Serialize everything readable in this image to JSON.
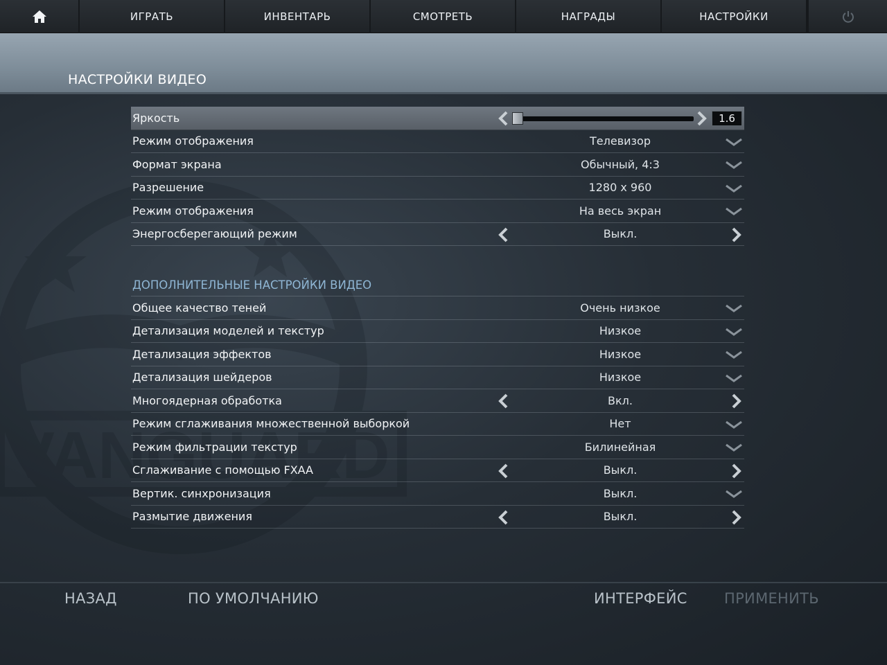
{
  "nav": {
    "items": [
      {
        "label": "ИГРАТЬ"
      },
      {
        "label": "ИНВЕНТАРЬ"
      },
      {
        "label": "СМОТРЕТЬ"
      },
      {
        "label": "НАГРАДЫ"
      },
      {
        "label": "НАСТРОЙКИ"
      }
    ],
    "home_icon": "home-icon",
    "power_icon": "power-icon"
  },
  "page": {
    "title": "НАСТРОЙКИ ВИДЕО"
  },
  "brightness": {
    "label": "Яркость",
    "value": "1.6",
    "slider_fraction": 0.0
  },
  "basic": [
    {
      "label": "Режим отображения",
      "value": "Телевизор",
      "control": "dropdown"
    },
    {
      "label": "Формат экрана",
      "value": "Обычный, 4:3",
      "control": "dropdown"
    },
    {
      "label": "Разрешение",
      "value": "1280 x 960",
      "control": "dropdown"
    },
    {
      "label": "Режим отображения",
      "value": "На весь экран",
      "control": "dropdown"
    },
    {
      "label": "Энергосберегающий режим",
      "value": "Выкл.",
      "control": "arrows"
    }
  ],
  "advanced": {
    "title": "ДОПОЛНИТЕЛЬНЫЕ НАСТРОЙКИ ВИДЕО",
    "rows": [
      {
        "label": "Общее качество теней",
        "value": "Очень низкое",
        "control": "dropdown"
      },
      {
        "label": "Детализация моделей и текстур",
        "value": "Низкое",
        "control": "dropdown"
      },
      {
        "label": "Детализация эффектов",
        "value": "Низкое",
        "control": "dropdown"
      },
      {
        "label": "Детализация шейдеров",
        "value": "Низкое",
        "control": "dropdown"
      },
      {
        "label": "Многоядерная обработка",
        "value": "Вкл.",
        "control": "arrows"
      },
      {
        "label": "Режим сглаживания множественной выборкой",
        "value": "Нет",
        "control": "dropdown"
      },
      {
        "label": "Режим фильтрации текстур",
        "value": "Билинейная",
        "control": "dropdown"
      },
      {
        "label": "Сглаживание с помощью FXAA",
        "value": "Выкл.",
        "control": "arrows"
      },
      {
        "label": "Вертик. синхронизация",
        "value": "Выкл.",
        "control": "dropdown"
      },
      {
        "label": "Размытие движения",
        "value": "Выкл.",
        "control": "arrows"
      }
    ]
  },
  "footer": {
    "back": "НАЗАД",
    "defaults": "ПО УМОЛЧАНИЮ",
    "interface": "ИНТЕРФЕЙС",
    "apply": "ПРИМЕНИТЬ"
  },
  "watermark": "VANGUARD",
  "colors": {
    "section_title": "#8fb6d4",
    "header_band": "#8b99a5",
    "apply_disabled": "#5c6770"
  }
}
